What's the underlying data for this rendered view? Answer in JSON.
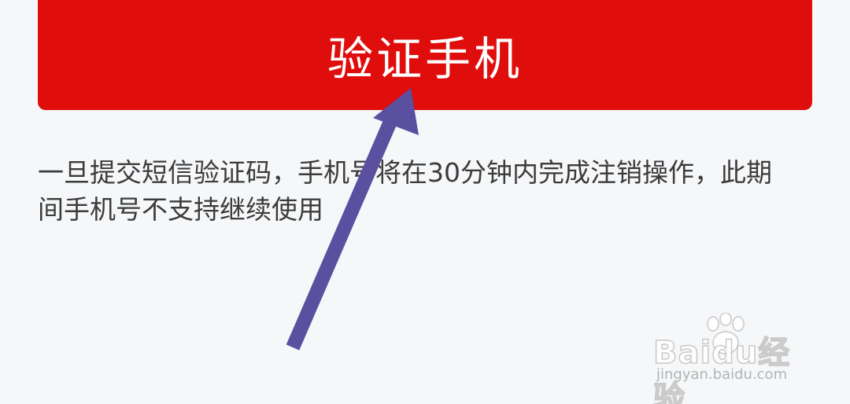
{
  "verify_button": {
    "label": "验证手机",
    "bg_color": "#e00d0d"
  },
  "notice": {
    "text": "一旦提交短信验证码，手机号将在30分钟内完成注销操作，此期间手机号不支持继续使用"
  },
  "annotation_arrow": {
    "color": "#5b4fa0"
  },
  "watermark": {
    "brand": "Baidu经验",
    "url": "jingyan.baidu.com"
  }
}
